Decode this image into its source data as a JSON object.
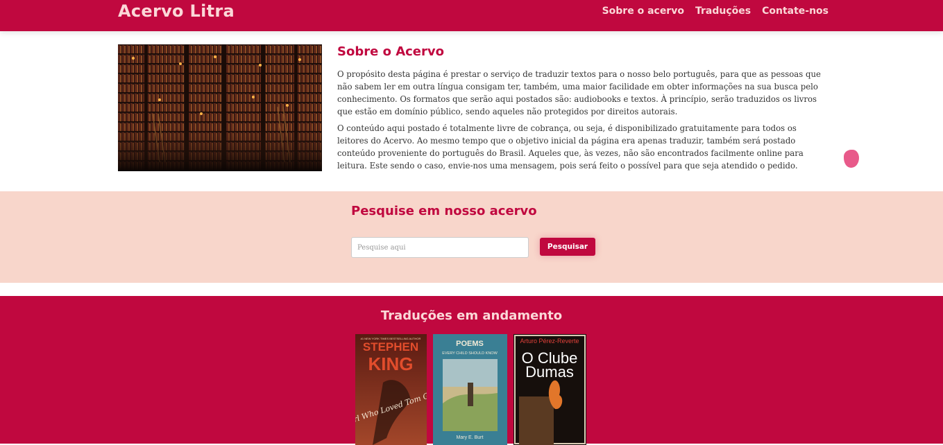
{
  "nav": {
    "brand": "Acervo Litra",
    "links": [
      "Sobre o acervo",
      "Traduções",
      "Contate-nos"
    ]
  },
  "about": {
    "title": "Sobre o Acervo",
    "image_alt": "library-image",
    "paragraphs": [
      "O propósito desta página é prestar o serviço de traduzir textos para o nosso belo português, para que as pessoas que não sabem ler em outra língua consigam ter, também, uma maior facilidade em obter informações na sua busca pelo conhecimento. Os formatos que serão aqui postados são: audiobooks e textos. À princípio, serão traduzidos os livros que estão em domínio público, sendo aqueles não protegidos por direitos autorais.",
      "O conteúdo aqui postado é totalmente livre de cobrança, ou seja, é disponibilizado gratuitamente para todos os leitores do Acervo. Ao mesmo tempo que o objetivo inicial da página era apenas traduzir, também será postado conteúdo proveniente do português do Brasil. Aqueles que, às vezes, não são encontrados facilmente online para leitura. Este sendo o caso, envie-nos uma mensagem, pois será feito o possível para que seja atendido o pedido."
    ]
  },
  "search": {
    "title": "Pesquise em nosso acervo",
    "placeholder": "Pesquise aqui",
    "value": "",
    "button": "Pesquisar"
  },
  "translations": {
    "title": "Traduções em andamento",
    "books": [
      {
        "top": "#1 NEW YORK TIMES BESTSELLING AUTHOR",
        "author": "STEPHEN",
        "author2": "KING",
        "title": "The Girl Who Loved Tom Gordon"
      },
      {
        "title": "POEMS",
        "subtitle": "EVERY CHILD SHOULD KNOW",
        "author": "Mary E. Burt"
      },
      {
        "author": "Arturo Pérez-Reverte",
        "title": "O Clube",
        "title2": "Dumas"
      }
    ]
  },
  "colors": {
    "brand": "#c0083f",
    "nav_text": "#fbd8d8",
    "search_band": "#f8d6cb"
  }
}
